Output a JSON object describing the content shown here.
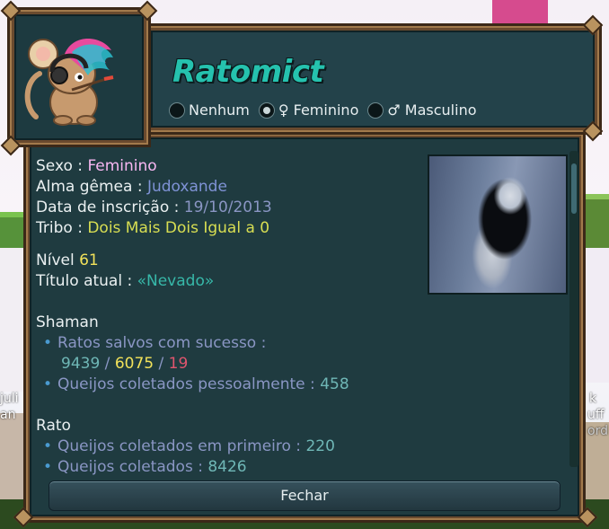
{
  "profile": {
    "name": "Ratomict",
    "gender_options": [
      {
        "label": "Nenhum",
        "selected": false
      },
      {
        "label": "♀ Feminino",
        "selected": true
      },
      {
        "label": "♂ Masculino",
        "selected": false
      }
    ],
    "info": {
      "sexo_label": "Sexo : ",
      "sexo_value": "Feminino",
      "alma_label": "Alma gêmea : ",
      "alma_value": "Judoxande",
      "data_label": "Data de inscrição : ",
      "data_value": "19/10/2013",
      "tribo_label": "Tribo : ",
      "tribo_value": "Dois Mais Dois Igual a 0",
      "nivel_label": "Nível ",
      "nivel_value": "61",
      "titulo_label": "Título atual : ",
      "titulo_value": "«Nevado»"
    },
    "shaman": {
      "heading": "Shaman",
      "saved_label": "Ratos salvos com sucesso :",
      "saved_normal": "9439",
      "sep1": " / ",
      "saved_hard": "6075",
      "sep2": " / ",
      "saved_divine": "19",
      "cheese_label": "Queijos coletados pessoalmente : ",
      "cheese_value": "458"
    },
    "rato": {
      "heading": "Rato",
      "first_label": "Queijos coletados em primeiro : ",
      "first_value": "220",
      "cheese_label": "Queijos coletados : ",
      "cheese_value": "8426"
    },
    "close_button": "Fechar"
  },
  "background_text": {
    "left_a": "juli",
    "left_b": "an",
    "right_a": "k",
    "right_b": "uff",
    "right_c": "ord"
  },
  "colors": {
    "name": "#25c2ae",
    "feminine": "#f7b7f2",
    "soulmate": "#7f93d6",
    "tribe": "#d8de52",
    "title": "#37b8a9",
    "divine": "#e0556e"
  },
  "icons": {
    "bullet": "•",
    "radio": "radio-circle"
  }
}
